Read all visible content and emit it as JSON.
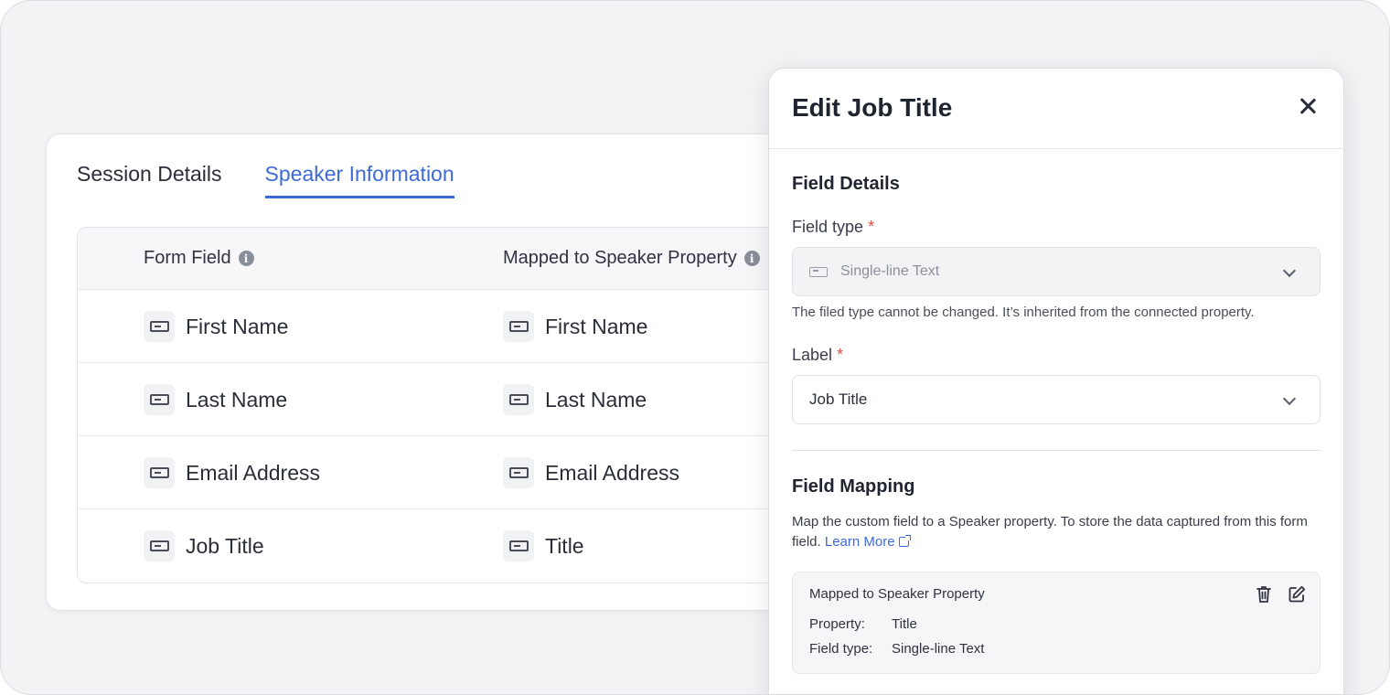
{
  "tabs": [
    {
      "label": "Session Details",
      "active": false
    },
    {
      "label": "Speaker Information",
      "active": true
    }
  ],
  "table": {
    "headers": {
      "form_field": "Form Field",
      "mapped": "Mapped to Speaker Property"
    },
    "rows": [
      {
        "form_field": "First Name",
        "mapped": "First Name"
      },
      {
        "form_field": "Last Name",
        "mapped": "Last Name"
      },
      {
        "form_field": "Email Address",
        "mapped": "Email Address"
      },
      {
        "form_field": "Job Title",
        "mapped": "Title"
      }
    ]
  },
  "panel": {
    "title": "Edit Job Title",
    "field_details": {
      "section_title": "Field Details",
      "field_type_label": "Field type",
      "field_type_value": "Single-line Text",
      "field_type_help": "The filed type cannot be changed. It’s inherited from the connected property.",
      "label_label": "Label",
      "label_value": "Job Title",
      "required_mark": "*"
    },
    "field_mapping": {
      "section_title": "Field Mapping",
      "description": "Map the custom field to a Speaker property. To store the data captured from this form field.",
      "learn_more": "Learn More",
      "mapped_box": {
        "title": "Mapped to Speaker Property",
        "property_key": "Property:",
        "property_value": "Title",
        "field_type_key": "Field type:",
        "field_type_value": "Single-line Text"
      }
    }
  },
  "colors": {
    "accent": "#3d6ad6",
    "required": "#e04b4b"
  }
}
